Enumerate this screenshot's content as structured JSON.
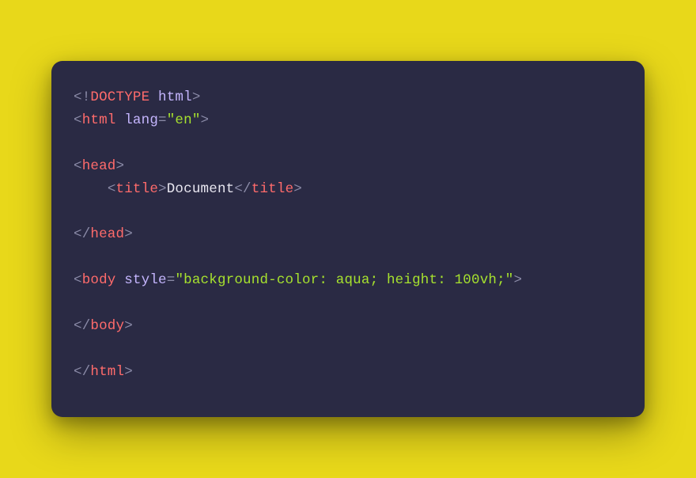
{
  "code": {
    "doctype": {
      "open": "<!",
      "name": "DOCTYPE",
      "space": " ",
      "value": "html",
      "close": ">"
    },
    "htmlOpen": {
      "open": "<",
      "tag": "html",
      "space": " ",
      "attr": "lang",
      "eq": "=",
      "val": "\"en\"",
      "close": ">"
    },
    "headOpen": {
      "open": "<",
      "tag": "head",
      "close": ">"
    },
    "title": {
      "indent": "    ",
      "open1": "<",
      "tag1": "title",
      "close1": ">",
      "text": "Document",
      "open2": "</",
      "tag2": "title",
      "close2": ">"
    },
    "headClose": {
      "open": "</",
      "tag": "head",
      "close": ">"
    },
    "bodyOpen": {
      "open": "<",
      "tag": "body",
      "space": " ",
      "attr": "style",
      "eq": "=",
      "val": "\"background-color: aqua; height: 100vh;\"",
      "close": ">"
    },
    "bodyClose": {
      "open": "</",
      "tag": "body",
      "close": ">"
    },
    "htmlClose": {
      "open": "</",
      "tag": "html",
      "close": ">"
    }
  }
}
